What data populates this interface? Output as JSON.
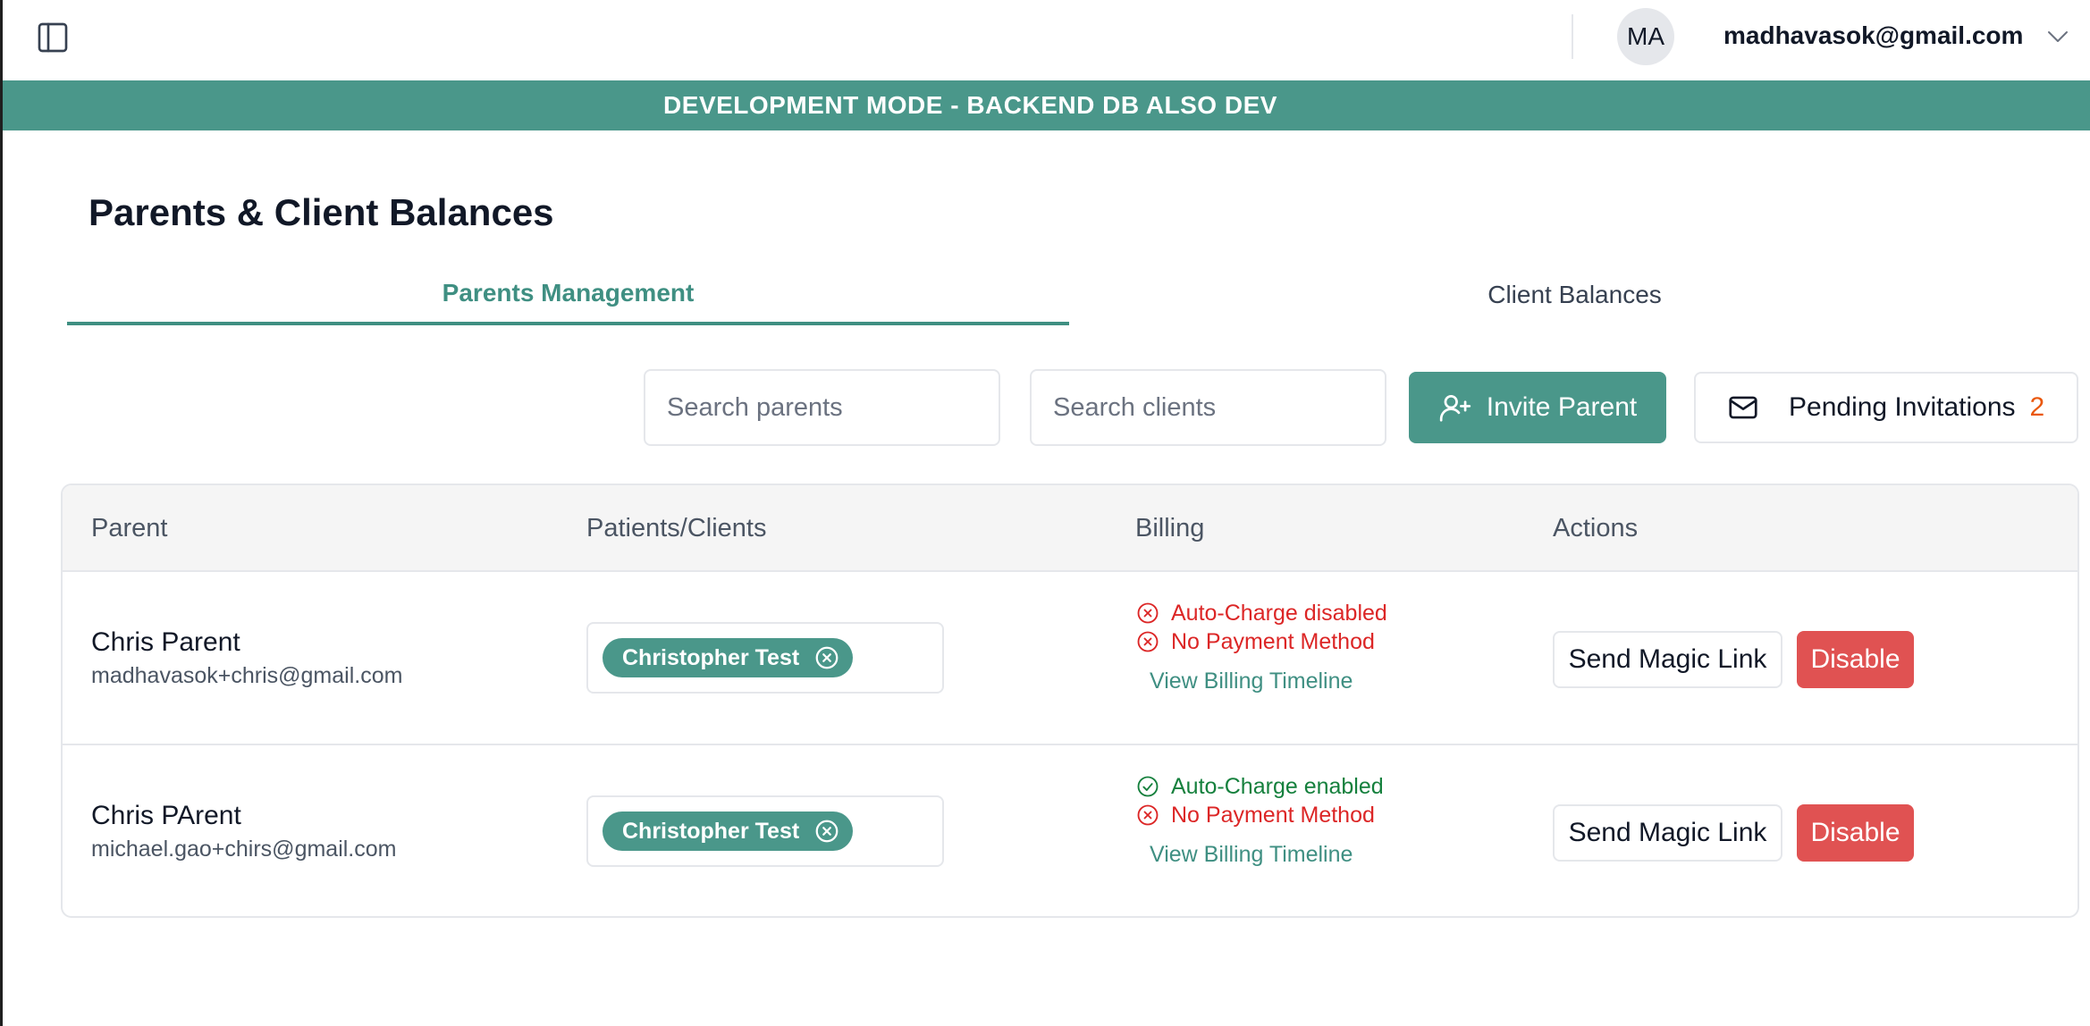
{
  "header": {
    "avatar_initials": "MA",
    "user_email": "madhavasok@gmail.com"
  },
  "banner": {
    "text": "DEVELOPMENT MODE - BACKEND DB ALSO DEV",
    "color": "#4a978a"
  },
  "page": {
    "title": "Parents & Client Balances"
  },
  "tabs": [
    {
      "label": "Parents Management",
      "active": true
    },
    {
      "label": "Client Balances",
      "active": false
    }
  ],
  "toolbar": {
    "search_parents_placeholder": "Search parents",
    "search_clients_placeholder": "Search clients",
    "invite_label": "Invite Parent",
    "pending_label": "Pending Invitations",
    "pending_count": "2"
  },
  "table": {
    "headers": [
      "Parent",
      "Patients/Clients",
      "Billing",
      "Actions"
    ],
    "rows": [
      {
        "name": "Chris Parent",
        "email": "madhavasok+chris@gmail.com",
        "client_chip": "Christopher Test",
        "auto_charge": "Auto-Charge disabled",
        "auto_charge_status": "error",
        "payment": "No Payment Method",
        "timeline_link": "View Billing Timeline",
        "magic_link_label": "Send Magic Link",
        "disable_label": "Disable"
      },
      {
        "name": "Chris PArent",
        "email": "michael.gao+chirs@gmail.com",
        "client_chip": "Christopher Test",
        "auto_charge": "Auto-Charge enabled",
        "auto_charge_status": "ok",
        "payment": "No Payment Method",
        "timeline_link": "View Billing Timeline",
        "magic_link_label": "Send Magic Link",
        "disable_label": "Disable"
      }
    ]
  },
  "icons": {
    "sidebar_toggle": "sidebar-toggle-icon",
    "user_menu": "chevron-down-icon",
    "invite": "user-plus-icon",
    "pending": "mail-icon",
    "chip_remove": "x-circle-icon",
    "billing_error": "x-circle-icon",
    "billing_ok": "check-circle-icon"
  },
  "colors": {
    "accent": "#4a978a",
    "danger": "#e05252",
    "error_text": "#dc2626",
    "success_text": "#15803d",
    "badge_count": "#ea580c"
  }
}
